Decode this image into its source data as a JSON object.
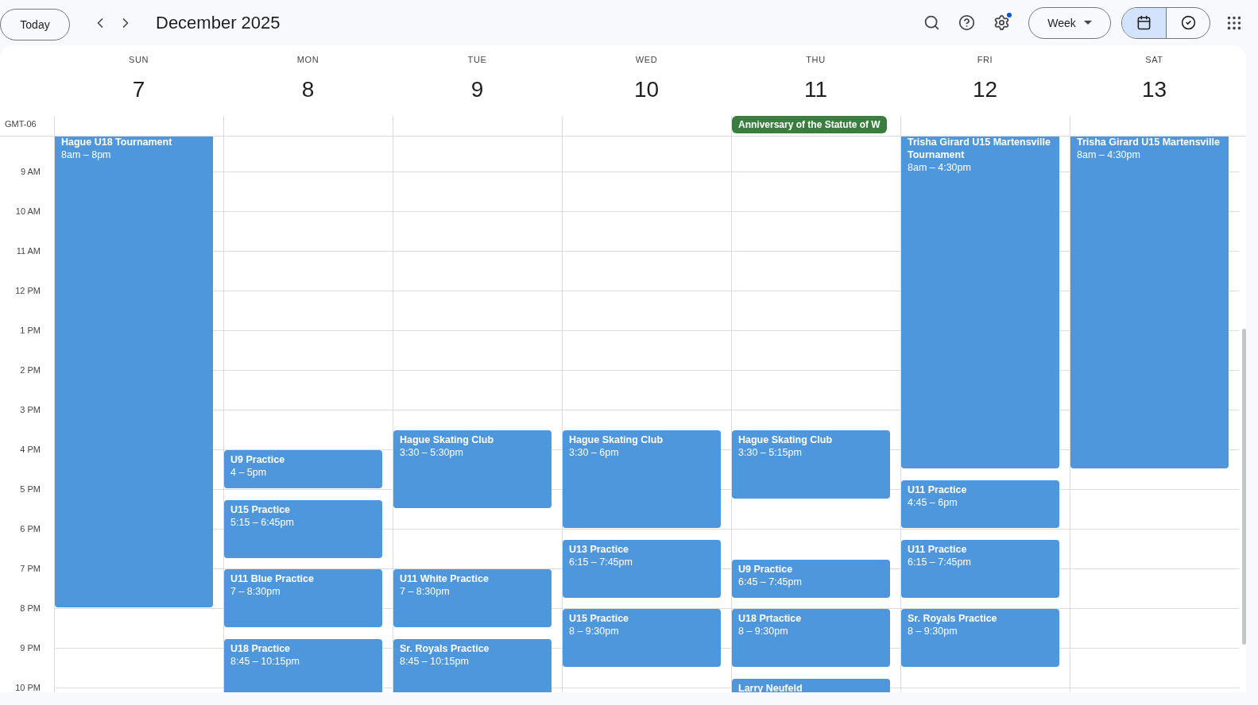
{
  "toolbar": {
    "today_button": "Today",
    "title": "December 2025",
    "settings_notification": true,
    "view_dropdown": "Week",
    "view_toggle": [
      {
        "kind": "calendar",
        "selected": true
      },
      {
        "kind": "tasks",
        "selected": false
      }
    ]
  },
  "timezone": "GMT-06",
  "hours": [
    "9 AM",
    "10 AM",
    "11 AM",
    "12 PM",
    "1 PM",
    "2 PM",
    "3 PM",
    "4 PM",
    "5 PM",
    "6 PM",
    "7 PM",
    "8 PM",
    "9 PM",
    "10 PM"
  ],
  "days": [
    {
      "weekday": "SUN",
      "date": "7",
      "events": [
        {
          "title": "Hague U18 Tournament",
          "time": "8am – 8pm"
        }
      ]
    },
    {
      "weekday": "MON",
      "date": "8",
      "events": [
        {
          "title": "U9 Practice",
          "time": "4 – 5pm"
        },
        {
          "title": "U15 Practice",
          "time": "5:15 – 6:45pm"
        },
        {
          "title": "U11 Blue Practice",
          "time": "7 – 8:30pm"
        },
        {
          "title": "U18 Practice",
          "time": "8:45 – 10:15pm"
        }
      ]
    },
    {
      "weekday": "TUE",
      "date": "9",
      "events": [
        {
          "title": "Hague Skating Club",
          "time": "3:30 – 5:30pm"
        },
        {
          "title": "U11 White Practice",
          "time": "7 – 8:30pm"
        },
        {
          "title": "Sr. Royals Practice",
          "time": "8:45 – 10:15pm"
        }
      ]
    },
    {
      "weekday": "WED",
      "date": "10",
      "events": [
        {
          "title": "Hague Skating Club",
          "time": "3:30 – 6pm"
        },
        {
          "title": "U13 Practice",
          "time": "6:15 – 7:45pm"
        },
        {
          "title": "U15 Practice",
          "time": "8 – 9:30pm"
        }
      ]
    },
    {
      "weekday": "THU",
      "date": "11",
      "all_day": [
        {
          "title": "Anniversary of the Statute of W"
        }
      ],
      "events": [
        {
          "title": "Hague Skating Club",
          "time": "3:30 – 5:15pm"
        },
        {
          "title": "U9 Practice",
          "time": "6:45 – 7:45pm"
        },
        {
          "title": "U18 Prtactice",
          "time": "8 – 9:30pm"
        },
        {
          "title": "Larry Neufeld"
        }
      ]
    },
    {
      "weekday": "FRI",
      "date": "12",
      "events": [
        {
          "title": "Trisha Girard U15 Martensville Tournament",
          "time": "8am – 4:30pm"
        },
        {
          "title": "U11 Practice",
          "time": "4:45 – 6pm"
        },
        {
          "title": "U11 Practice",
          "time": "6:15 – 7:45pm"
        },
        {
          "title": "Sr. Royals Practice",
          "time": "8 – 9:30pm"
        }
      ]
    },
    {
      "weekday": "SAT",
      "date": "13",
      "events": [
        {
          "title": "Trisha Girard U15 Martensville",
          "time": "8am – 4:30pm"
        }
      ]
    }
  ]
}
